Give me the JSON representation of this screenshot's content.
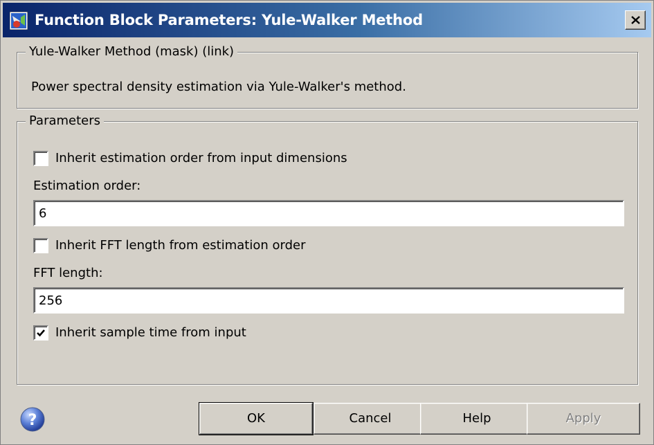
{
  "window": {
    "title": "Function Block Parameters: Yule-Walker Method"
  },
  "description_group": {
    "legend": "Yule-Walker Method (mask) (link)",
    "text": "Power spectral density estimation via Yule-Walker's method."
  },
  "parameters": {
    "legend": "Parameters",
    "inherit_order": {
      "label": "Inherit estimation order from input dimensions",
      "checked": false
    },
    "estimation_order": {
      "label": "Estimation order:",
      "value": "6"
    },
    "inherit_fft": {
      "label": "Inherit FFT length from estimation order",
      "checked": false
    },
    "fft_length": {
      "label": "FFT length:",
      "value": "256"
    },
    "inherit_sample_time": {
      "label": "Inherit sample time from input",
      "checked": true
    }
  },
  "buttons": {
    "ok": "OK",
    "cancel": "Cancel",
    "help": "Help",
    "apply": "Apply"
  },
  "colors": {
    "title_start": "#0a246a",
    "title_end": "#a6caf0",
    "face": "#d4d0c8"
  }
}
